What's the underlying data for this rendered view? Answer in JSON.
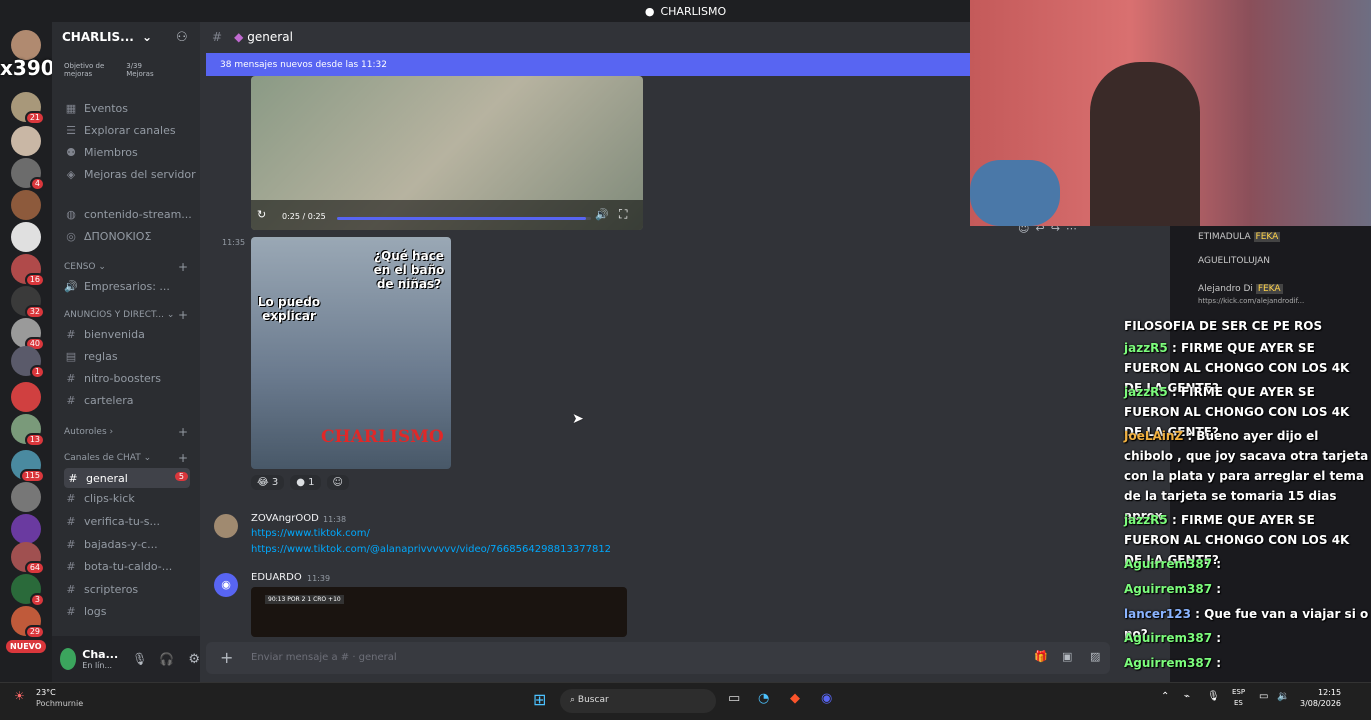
{
  "window": {
    "title": "CHARLISMO"
  },
  "stream_overlay": {
    "counter": "x390"
  },
  "server": {
    "name": "CHARLIS...",
    "boost_label": "Objetivo de mejoras",
    "boost_progress": "3/39 Mejoras"
  },
  "server_badges": [
    "21",
    "4",
    "16",
    "32",
    "40",
    "1",
    "13",
    "115",
    "64",
    "3",
    "29"
  ],
  "rail_new_label": "NUEVO",
  "sidebar": {
    "top_items": [
      "Eventos",
      "Explorar canales",
      "Miembros",
      "Mejoras del servidor"
    ],
    "stream_items": [
      "contenido-stream...",
      "ΔΠΟΝΟΚΙΟΣ"
    ],
    "categories": [
      {
        "name": "CENSO",
        "channels": [
          "Empresarios: ..."
        ]
      },
      {
        "name": "ANUNCIOS Y DIRECT...",
        "channels": [
          "bienvenida",
          "reglas",
          "nitro-boosters",
          "cartelera"
        ]
      },
      {
        "name": "Autoroles",
        "channels": []
      },
      {
        "name": "Canales de CHAT",
        "channels": [
          "general",
          "clips-kick",
          "verifica-tu-s...",
          "bajadas-y-c...",
          "bota-tu-caldo-...",
          "scripteros",
          "logs"
        ]
      }
    ],
    "general_unread": "5",
    "user": {
      "name": "Cha...",
      "status": "En lín..."
    }
  },
  "chat": {
    "channel": "general",
    "new_messages_bar": "38 mensajes nuevos desde las 11:32",
    "video": {
      "time": "0:25 / 0:25",
      "progress": 0.98
    },
    "msg1_time": "11:35",
    "meme_text": {
      "caption1": "¿Qué hace en el baño de niñas?",
      "caption2": "Lo puedo explicar",
      "watermark": "CHARLISMO"
    },
    "reactions": [
      {
        "count": "3"
      },
      {
        "count": "1"
      }
    ],
    "msg2": {
      "user": "ZOVAngrOOD",
      "time": "11:38",
      "links": [
        "https://www.tiktok.com/",
        "https://www.tiktok.com/@alanaprivvvvvv/video/7668564298813377812"
      ]
    },
    "msg3": {
      "user": "EDUARDO",
      "time": "11:39",
      "scoreboard": "90:13 POR 2 1 CRO +10"
    },
    "composer_placeholder": "Enviar mensaje a # · general"
  },
  "stream_chat": [
    {
      "user": "",
      "text": "FILOSOFIA DE SER CE PE ROS",
      "color": "#ffffff"
    },
    {
      "user": "jazzR5",
      "text": ": FIRME QUE AYER SE FUERON AL CHONGO CON LOS 4K DE LA GENTE?",
      "color": "#7cfc7c"
    },
    {
      "user": "jazzR5",
      "text": ": FIRME QUE AYER SE FUERON AL CHONGO CON LOS 4K DE LA GENTE?",
      "color": "#7cfc7c"
    },
    {
      "user": "JoeLAinZ",
      "text": ": Bueno ayer dijo el chibolo , que joy sacava otra tarjeta con la plata y para arreglar el tema de la tarjeta se tomaria 15 dias aprox",
      "color": "#f0b040"
    },
    {
      "user": "jazzR5",
      "text": ": FIRME QUE AYER SE FUERON AL CHONGO CON LOS 4K DE LA GENTE?",
      "color": "#7cfc7c"
    },
    {
      "user": "Aguirrem387",
      "text": ":",
      "color": "#7cfc7c"
    },
    {
      "user": "Aguirrem387",
      "text": ":",
      "color": "#7cfc7c"
    },
    {
      "user": "lancer123",
      "text": ": Que fue van a viajar si o no?",
      "color": "#8ab4ff"
    },
    {
      "user": "Aguirrem387",
      "text": ":",
      "color": "#7cfc7c"
    },
    {
      "user": "Aguirrem387",
      "text": ":",
      "color": "#7cfc7c"
    }
  ],
  "kick_chat": [
    {
      "user": "ETIMADULA",
      "tag": "FEKA"
    },
    {
      "user": "AGUELITOLUJAN",
      "tag": ""
    },
    {
      "user": "Alejandro Di",
      "tag": "FEKA",
      "link": "https://kick.com/alejandrodif..."
    }
  ],
  "taskbar": {
    "weather": {
      "temp": "23°C",
      "place": "Pochmurnie"
    },
    "search": "Buscar",
    "lang": {
      "top": "ESP",
      "bottom": "ES"
    },
    "time": "12:15",
    "date": "3/08/2026"
  }
}
